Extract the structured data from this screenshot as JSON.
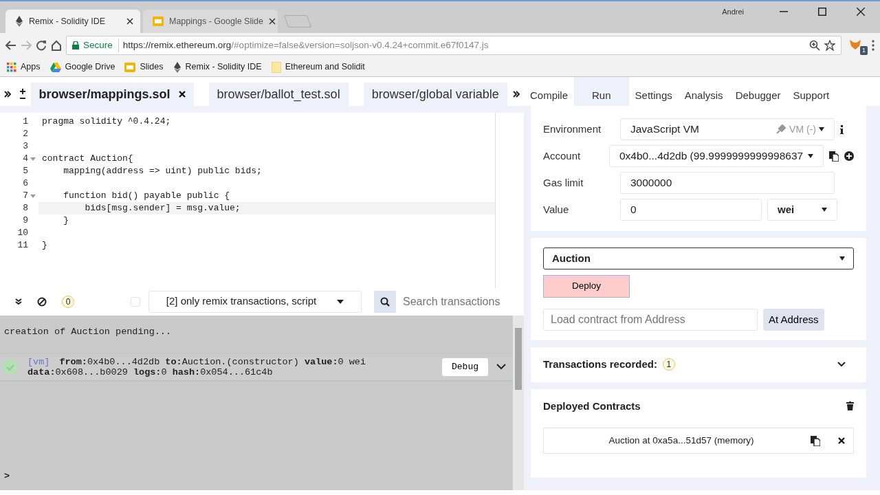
{
  "browser": {
    "tabs": [
      {
        "title": "Remix - Solidity IDE",
        "selected": true
      },
      {
        "title": "Mappings - Google Slide",
        "selected": false
      }
    ],
    "user": "Andrei",
    "address": {
      "secure_label": "Secure",
      "host": "https://remix.ethereum.org",
      "path": "/#optimize=false&version=soljson-v0.4.24+commit.e67f0147.js"
    },
    "extension_badge": "1",
    "bookmarks": [
      {
        "label": "Apps"
      },
      {
        "label": "Google Drive"
      },
      {
        "label": "Slides"
      },
      {
        "label": "Remix - Solidity IDE"
      },
      {
        "label": "Ethereum and Solidit"
      }
    ]
  },
  "file_tabs": [
    {
      "label": "browser/mappings.sol",
      "selected": true
    },
    {
      "label": "browser/ballot_test.sol",
      "selected": false
    },
    {
      "label": "browser/global variable",
      "selected": false
    }
  ],
  "panel_tabs": [
    {
      "label": "Compile",
      "selected": false
    },
    {
      "label": "Run",
      "selected": true
    },
    {
      "label": "Settings",
      "selected": false
    },
    {
      "label": "Analysis",
      "selected": false
    },
    {
      "label": "Debugger",
      "selected": false
    },
    {
      "label": "Support",
      "selected": false
    }
  ],
  "code": [
    {
      "number": "1",
      "text": "pragma solidity ^0.4.24;",
      "fold": false,
      "current": false
    },
    {
      "number": "2",
      "fold": false,
      "current": false
    },
    {
      "number": "3",
      "fold": false,
      "current": false
    },
    {
      "number": "4",
      "text": "contract Auction{",
      "fold": true,
      "current": false
    },
    {
      "number": "5",
      "text": "    mapping(address => uint) public bids;",
      "fold": false,
      "current": false
    },
    {
      "number": "6",
      "fold": false,
      "current": false
    },
    {
      "number": "7",
      "text": "    function bid() payable public {",
      "fold": true,
      "current": false
    },
    {
      "number": "8",
      "text": "        bids[msg.sender] = msg.value;",
      "fold": false,
      "current": true
    },
    {
      "number": "9",
      "text": "    }",
      "fold": false,
      "current": false
    },
    {
      "number": "10",
      "fold": false,
      "current": false
    },
    {
      "number": "11",
      "text": "}",
      "fold": false,
      "current": false
    }
  ],
  "terminal": {
    "pending_count": "0",
    "listen_checked": false,
    "filter": "[2] only remix transactions, script",
    "search": {
      "placeholder": "Search transactions"
    },
    "log": "creation of Auction pending...",
    "transaction": {
      "tag": "[vm]",
      "line_1": "**from:**0x4b0...4d2db **to:**Auction.(constructor) **value:**0 wei",
      "line_2": "**data:**0x608...b0029 **logs:**0 **hash:**0x054...61c4b",
      "button": "Debug"
    },
    "prompt": ">"
  },
  "run": {
    "environment": {
      "label": "Environment",
      "value": "JavaScript VM",
      "status": "VM (-)"
    },
    "account": {
      "label": "Account",
      "value": "0x4b0...4d2db (99.9999999999998637"
    },
    "gas_limit": {
      "label": "Gas limit",
      "value": "3000000"
    },
    "value": {
      "label": "Value",
      "value": "0",
      "unit": "wei"
    },
    "contract": "Auction",
    "deploy": "Deploy",
    "load": {
      "placeholder": "Load contract from Address",
      "button": "At Address"
    },
    "transactions": {
      "label": "Transactions recorded:",
      "count": "1"
    },
    "deployed": {
      "title": "Deployed Contracts",
      "instances": [
        "Auction at 0xa5a...51d57 (memory)"
      ]
    }
  }
}
